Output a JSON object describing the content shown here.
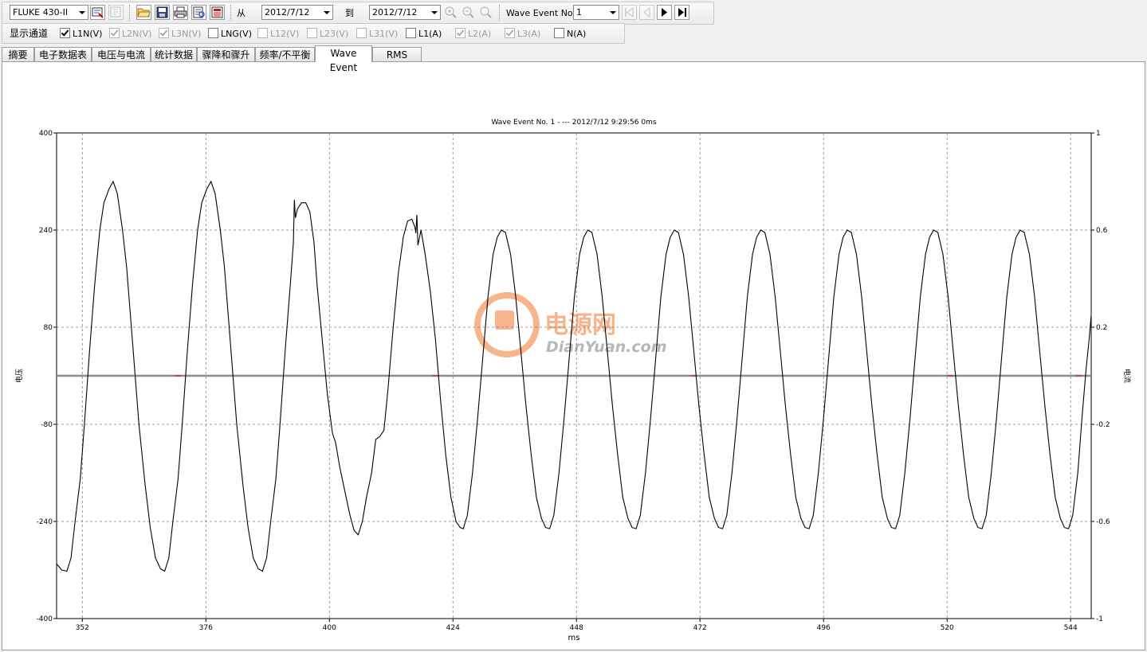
{
  "toolbar": {
    "device": "FLUKE 430-II",
    "from_label": "从",
    "from_date": "2012/7/12",
    "to_label": "到",
    "to_date": "2012/7/12",
    "event_label": "Wave Event No.",
    "event_value": "1"
  },
  "channels": {
    "label": "显示通道",
    "items": [
      {
        "label": "L1N(V)",
        "checked": true,
        "enabled": true
      },
      {
        "label": "L2N(V)",
        "checked": true,
        "enabled": false
      },
      {
        "label": "L3N(V)",
        "checked": true,
        "enabled": false
      },
      {
        "label": "LNG(V)",
        "checked": false,
        "enabled": true
      },
      {
        "label": "L12(V)",
        "checked": false,
        "enabled": false
      },
      {
        "label": "L23(V)",
        "checked": false,
        "enabled": false
      },
      {
        "label": "L31(V)",
        "checked": false,
        "enabled": false
      },
      {
        "label": "L1(A)",
        "checked": false,
        "enabled": true
      },
      {
        "label": "L2(A)",
        "checked": true,
        "enabled": false
      },
      {
        "label": "L3(A)",
        "checked": true,
        "enabled": false
      },
      {
        "label": "N(A)",
        "checked": false,
        "enabled": true
      }
    ]
  },
  "tabs": [
    {
      "label": "摘要"
    },
    {
      "label": "电子数据表"
    },
    {
      "label": "电压与电流"
    },
    {
      "label": "统计数据"
    },
    {
      "label": "骤降和骤升"
    },
    {
      "label": "频率/不平衡"
    },
    {
      "label": "Wave Event",
      "active": true
    },
    {
      "label": "RMS Event"
    }
  ],
  "watermark": {
    "brand": "电源网",
    "domain": "DianYuan.com"
  },
  "colors": {
    "trace": "#000000",
    "grid": "#808080",
    "flat": "#8c8c8c",
    "flat_red": "#d03030",
    "logo": "#f5a878"
  },
  "chart_data": {
    "type": "line",
    "title": "Wave Event No. 1 -  ---  2012/7/12 9:29:56 0ms",
    "xlabel": "ms",
    "ylabel": "电压",
    "y2label": "电流",
    "xlim": [
      347,
      548
    ],
    "ylim": [
      -400,
      400
    ],
    "y2lim": [
      -1,
      1
    ],
    "xticks": [
      352,
      376,
      400,
      424,
      448,
      472,
      496,
      520,
      544
    ],
    "yticks": [
      400,
      240,
      80,
      -80,
      -240,
      -400
    ],
    "y2ticks": [
      1,
      0.6,
      0.2,
      -0.2,
      -0.6,
      -1
    ],
    "grid": true,
    "series": [
      {
        "name": "L1N(V)",
        "points": [
          [
            347.0,
            -310
          ],
          [
            348.0,
            -320
          ],
          [
            349.0,
            -322
          ],
          [
            349.8,
            -300
          ],
          [
            350.6,
            -240
          ],
          [
            351.6,
            -170
          ],
          [
            352.4,
            -80
          ],
          [
            353.4,
            40
          ],
          [
            354.4,
            150
          ],
          [
            355.4,
            240
          ],
          [
            356.2,
            285
          ],
          [
            357.2,
            308
          ],
          [
            358.0,
            320
          ],
          [
            358.8,
            300
          ],
          [
            359.8,
            240
          ],
          [
            360.6,
            180
          ],
          [
            361.8,
            50
          ],
          [
            363.0,
            -80
          ],
          [
            364.2,
            -180
          ],
          [
            365.2,
            -250
          ],
          [
            366.2,
            -300
          ],
          [
            367.2,
            -318
          ],
          [
            368.0,
            -322
          ],
          [
            368.8,
            -300
          ],
          [
            369.6,
            -240
          ],
          [
            370.6,
            -170
          ],
          [
            371.4,
            -80
          ],
          [
            372.4,
            40
          ],
          [
            373.4,
            150
          ],
          [
            374.4,
            240
          ],
          [
            375.2,
            285
          ],
          [
            376.2,
            308
          ],
          [
            377.0,
            320
          ],
          [
            377.8,
            300
          ],
          [
            378.8,
            240
          ],
          [
            379.6,
            180
          ],
          [
            380.8,
            50
          ],
          [
            382.0,
            -80
          ],
          [
            383.2,
            -180
          ],
          [
            384.2,
            -250
          ],
          [
            385.2,
            -300
          ],
          [
            386.2,
            -318
          ],
          [
            387.0,
            -322
          ],
          [
            387.8,
            -300
          ],
          [
            388.6,
            -240
          ],
          [
            389.6,
            -170
          ],
          [
            390.4,
            -80
          ],
          [
            391.4,
            40
          ],
          [
            392.4,
            150
          ],
          [
            393.0,
            220
          ],
          [
            393.2,
            290
          ],
          [
            393.4,
            260
          ],
          [
            393.8,
            275
          ],
          [
            394.6,
            285
          ],
          [
            395.4,
            285
          ],
          [
            396.2,
            270
          ],
          [
            397.0,
            220
          ],
          [
            397.6,
            150
          ],
          [
            398.6,
            60
          ],
          [
            399.6,
            -30
          ],
          [
            400.6,
            -95
          ],
          [
            401.2,
            -110
          ],
          [
            402.0,
            -150
          ],
          [
            403.0,
            -190
          ],
          [
            404.0,
            -230
          ],
          [
            404.8,
            -255
          ],
          [
            405.6,
            -262
          ],
          [
            406.4,
            -240
          ],
          [
            407.2,
            -200
          ],
          [
            408.2,
            -160
          ],
          [
            409.0,
            -105
          ],
          [
            409.8,
            -100
          ],
          [
            410.6,
            -90
          ],
          [
            411.4,
            -20
          ],
          [
            412.4,
            80
          ],
          [
            413.4,
            170
          ],
          [
            414.4,
            230
          ],
          [
            415.2,
            255
          ],
          [
            416.0,
            258
          ],
          [
            416.6,
            245
          ],
          [
            416.8,
            235
          ],
          [
            417.0,
            265
          ],
          [
            417.2,
            215
          ],
          [
            417.8,
            240
          ],
          [
            418.6,
            200
          ],
          [
            419.6,
            140
          ],
          [
            420.6,
            60
          ],
          [
            421.6,
            -40
          ],
          [
            422.6,
            -130
          ],
          [
            423.6,
            -200
          ],
          [
            424.6,
            -240
          ],
          [
            425.4,
            -250
          ],
          [
            426.0,
            -252
          ],
          [
            426.8,
            -230
          ],
          [
            427.8,
            -160
          ],
          [
            428.8,
            -70
          ],
          [
            429.8,
            30
          ],
          [
            430.8,
            130
          ],
          [
            431.8,
            200
          ],
          [
            432.6,
            228
          ],
          [
            433.4,
            240
          ],
          [
            434.2,
            236
          ],
          [
            435.2,
            200
          ],
          [
            436.2,
            130
          ],
          [
            437.2,
            40
          ],
          [
            438.2,
            -50
          ],
          [
            439.2,
            -130
          ],
          [
            440.2,
            -200
          ],
          [
            441.2,
            -235
          ],
          [
            442.0,
            -250
          ],
          [
            442.8,
            -252
          ],
          [
            443.6,
            -230
          ],
          [
            444.6,
            -160
          ],
          [
            445.6,
            -70
          ],
          [
            446.6,
            30
          ],
          [
            447.6,
            130
          ],
          [
            448.6,
            200
          ],
          [
            449.4,
            228
          ],
          [
            450.2,
            240
          ],
          [
            451.0,
            236
          ],
          [
            452.0,
            200
          ],
          [
            453.0,
            130
          ],
          [
            454.0,
            40
          ],
          [
            455.0,
            -50
          ],
          [
            456.0,
            -130
          ],
          [
            457.0,
            -200
          ],
          [
            458.0,
            -235
          ],
          [
            458.8,
            -250
          ],
          [
            459.6,
            -252
          ],
          [
            460.4,
            -230
          ],
          [
            461.4,
            -160
          ],
          [
            462.4,
            -70
          ],
          [
            463.4,
            30
          ],
          [
            464.4,
            130
          ],
          [
            465.4,
            200
          ],
          [
            466.2,
            228
          ],
          [
            467.0,
            240
          ],
          [
            467.8,
            236
          ],
          [
            468.8,
            200
          ],
          [
            469.8,
            130
          ],
          [
            470.8,
            40
          ],
          [
            471.8,
            -50
          ],
          [
            472.8,
            -130
          ],
          [
            473.8,
            -200
          ],
          [
            474.8,
            -235
          ],
          [
            475.6,
            -250
          ],
          [
            476.4,
            -252
          ],
          [
            477.2,
            -230
          ],
          [
            478.2,
            -160
          ],
          [
            479.2,
            -70
          ],
          [
            480.2,
            30
          ],
          [
            481.2,
            130
          ],
          [
            482.2,
            200
          ],
          [
            483.0,
            228
          ],
          [
            483.8,
            240
          ],
          [
            484.6,
            236
          ],
          [
            485.6,
            200
          ],
          [
            486.6,
            130
          ],
          [
            487.6,
            40
          ],
          [
            488.6,
            -50
          ],
          [
            489.6,
            -130
          ],
          [
            490.6,
            -200
          ],
          [
            491.6,
            -235
          ],
          [
            492.4,
            -250
          ],
          [
            493.2,
            -252
          ],
          [
            494.0,
            -230
          ],
          [
            495.0,
            -160
          ],
          [
            496.0,
            -70
          ],
          [
            497.0,
            30
          ],
          [
            498.0,
            130
          ],
          [
            499.0,
            200
          ],
          [
            499.8,
            228
          ],
          [
            500.6,
            240
          ],
          [
            501.4,
            236
          ],
          [
            502.4,
            200
          ],
          [
            503.4,
            130
          ],
          [
            504.4,
            40
          ],
          [
            505.4,
            -50
          ],
          [
            506.4,
            -130
          ],
          [
            507.4,
            -200
          ],
          [
            508.4,
            -235
          ],
          [
            509.2,
            -250
          ],
          [
            510.0,
            -252
          ],
          [
            510.8,
            -230
          ],
          [
            511.8,
            -160
          ],
          [
            512.8,
            -70
          ],
          [
            513.8,
            30
          ],
          [
            514.8,
            130
          ],
          [
            515.8,
            200
          ],
          [
            516.6,
            228
          ],
          [
            517.4,
            240
          ],
          [
            518.2,
            236
          ],
          [
            519.2,
            200
          ],
          [
            520.2,
            130
          ],
          [
            521.2,
            40
          ],
          [
            522.2,
            -50
          ],
          [
            523.2,
            -130
          ],
          [
            524.2,
            -200
          ],
          [
            525.2,
            -235
          ],
          [
            526.0,
            -250
          ],
          [
            526.8,
            -252
          ],
          [
            527.6,
            -230
          ],
          [
            528.6,
            -160
          ],
          [
            529.6,
            -70
          ],
          [
            530.6,
            30
          ],
          [
            531.6,
            130
          ],
          [
            532.6,
            200
          ],
          [
            533.4,
            228
          ],
          [
            534.2,
            240
          ],
          [
            535.0,
            236
          ],
          [
            536.0,
            200
          ],
          [
            537.0,
            130
          ],
          [
            538.0,
            40
          ],
          [
            539.0,
            -50
          ],
          [
            540.0,
            -130
          ],
          [
            541.0,
            -200
          ],
          [
            542.0,
            -235
          ],
          [
            542.8,
            -250
          ],
          [
            543.6,
            -252
          ],
          [
            544.4,
            -230
          ],
          [
            545.4,
            -160
          ],
          [
            546.2,
            -70
          ],
          [
            547.0,
            10
          ],
          [
            547.6,
            60
          ],
          [
            548.0,
            100
          ]
        ]
      },
      {
        "name": "flat",
        "y": 0
      }
    ]
  }
}
